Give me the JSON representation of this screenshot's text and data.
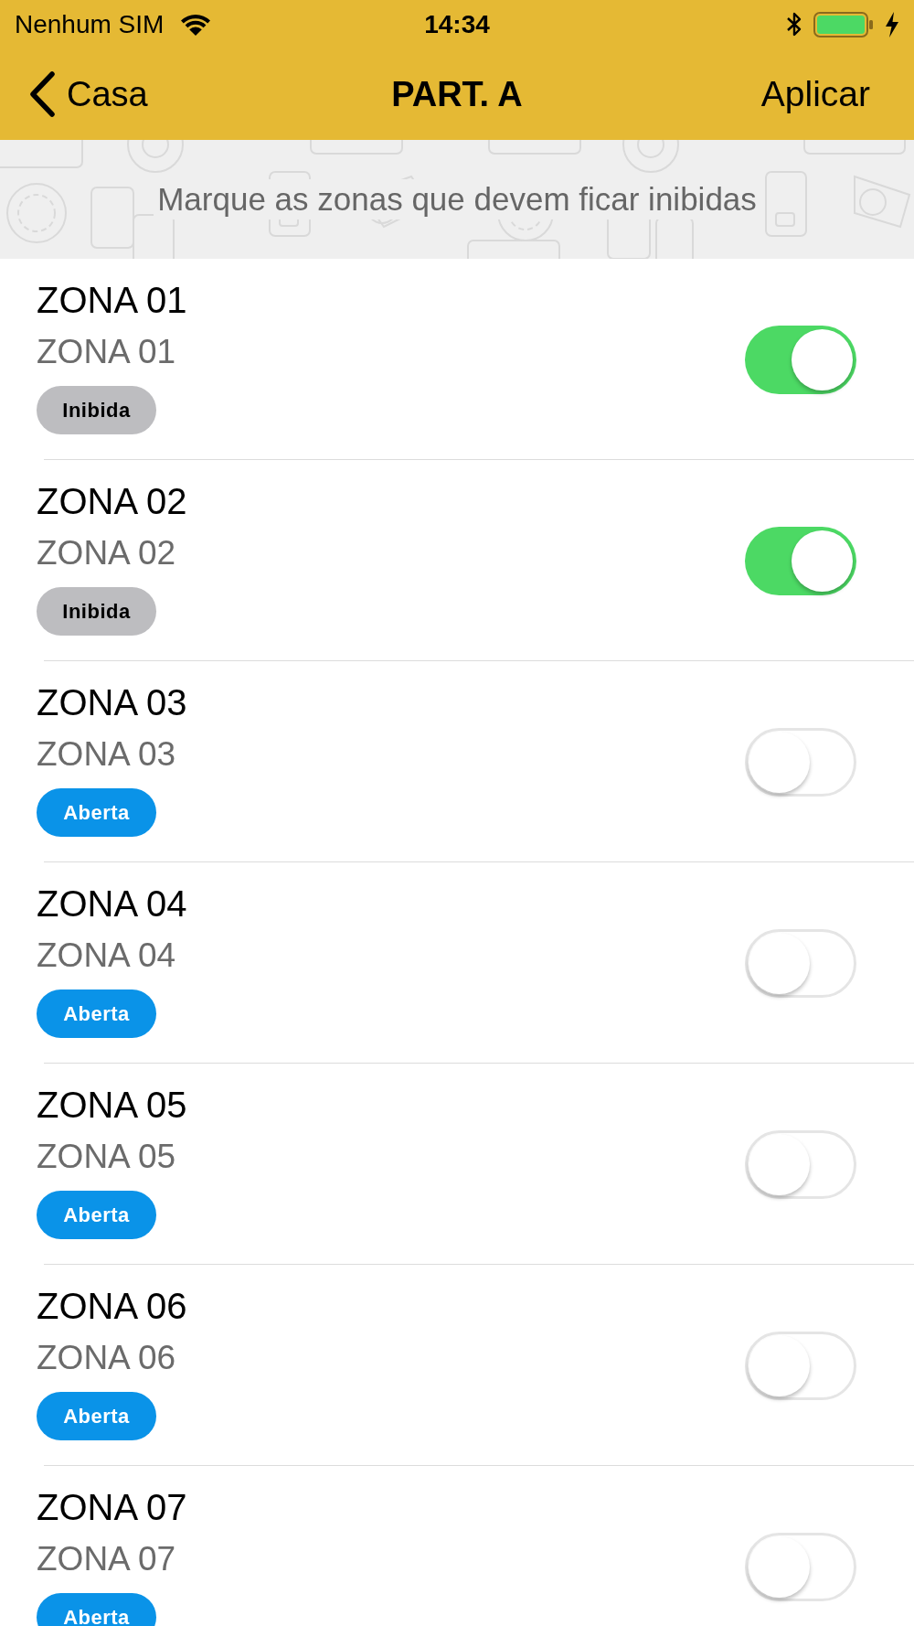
{
  "status_bar": {
    "carrier": "Nenhum SIM",
    "time": "14:34"
  },
  "nav_bar": {
    "back_label": "Casa",
    "title": "PART. A",
    "action": "Aplicar"
  },
  "banner": {
    "text": "Marque as zonas que devem ficar inibidas"
  },
  "zones": [
    {
      "name": "ZONA 01",
      "description": "ZONA 01",
      "status": {
        "label": "Inibida",
        "color": "#bdbdc0"
      },
      "on": true
    },
    {
      "name": "ZONA 02",
      "description": "ZONA 02",
      "status": {
        "label": "Inibida",
        "color": "#bdbdc0"
      },
      "on": true
    },
    {
      "name": "ZONA 03",
      "description": "ZONA 03",
      "status": {
        "label": "Aberta",
        "color": "#0a93e8"
      },
      "on": false
    },
    {
      "name": "ZONA 04",
      "description": "ZONA 04",
      "status": {
        "label": "Aberta",
        "color": "#0a93e8"
      },
      "on": false
    },
    {
      "name": "ZONA 05",
      "description": "ZONA 05",
      "status": {
        "label": "Aberta",
        "color": "#0a93e8"
      },
      "on": false
    },
    {
      "name": "ZONA 06",
      "description": "ZONA 06",
      "status": {
        "label": "Aberta",
        "color": "#0a93e8"
      },
      "on": false
    },
    {
      "name": "ZONA 07",
      "description": "ZONA 07",
      "status": {
        "label": "Aberta",
        "color": "#0a93e8"
      },
      "on": false
    }
  ]
}
